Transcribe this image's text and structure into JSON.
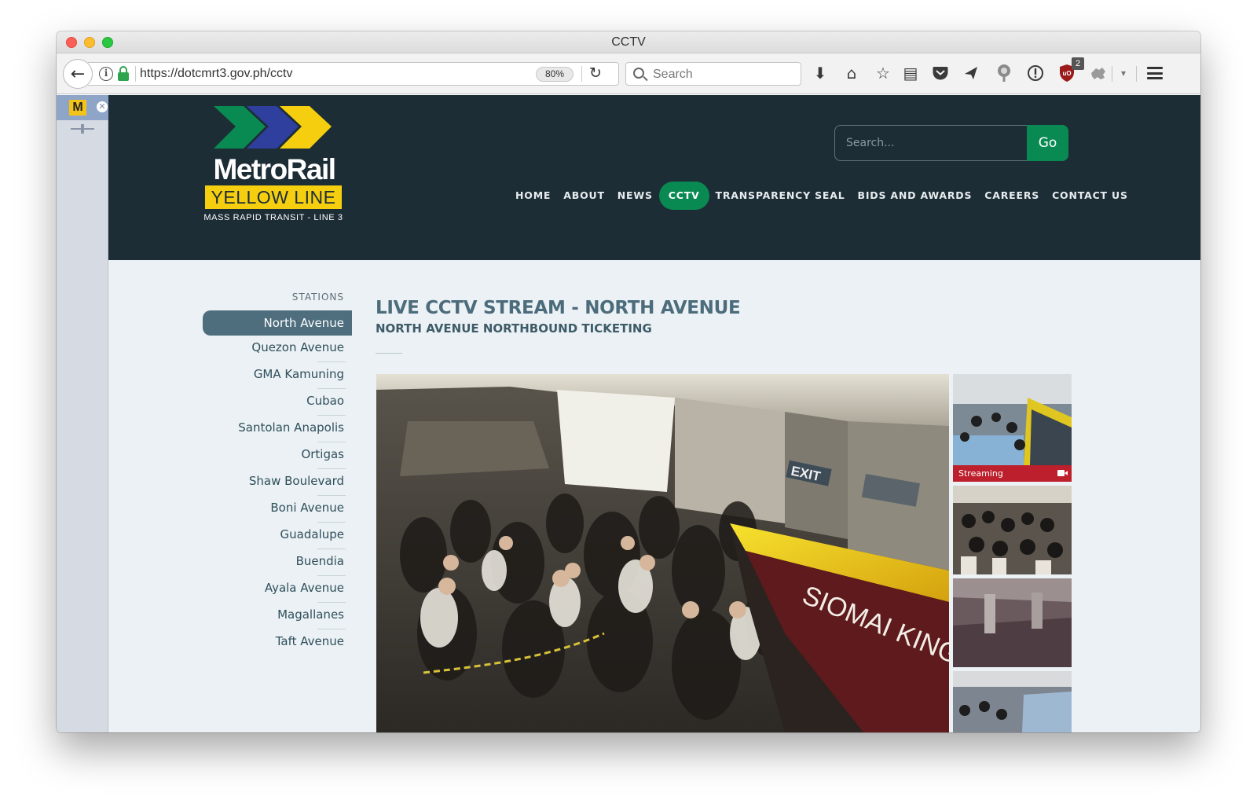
{
  "window": {
    "title": "CCTV"
  },
  "toolbar": {
    "url": "https://dotcmrt3.gov.ph/cctv",
    "zoom": "80%",
    "search_placeholder": "Search",
    "ublock_count": "2",
    "icons": [
      "back-icon",
      "info-icon",
      "lock-icon",
      "reload-icon",
      "search-icon",
      "download-icon",
      "home-icon",
      "bookmark-star-icon",
      "reader-icon",
      "pocket-icon",
      "send-icon",
      "extension-icon",
      "password-icon",
      "ublock-icon",
      "puzzle-icon",
      "dropdown-icon",
      "menu-icon"
    ]
  },
  "tab_strip": {
    "active_tab_letter": "M"
  },
  "site": {
    "logo": {
      "word": "MetroRail",
      "line": "YELLOW LINE",
      "subtitle": "MASS RAPID TRANSIT - LINE 3",
      "colors": [
        "#0a8a53",
        "#2e3f9e",
        "#f5cf0f"
      ]
    },
    "search": {
      "placeholder": "Search...",
      "button": "Go"
    },
    "nav": [
      {
        "label": "HOME",
        "active": false
      },
      {
        "label": "ABOUT",
        "active": false
      },
      {
        "label": "NEWS",
        "active": false
      },
      {
        "label": "CCTV",
        "active": true
      },
      {
        "label": "TRANSPARENCY SEAL",
        "active": false
      },
      {
        "label": "BIDS AND AWARDS",
        "active": false
      },
      {
        "label": "CAREERS",
        "active": false
      },
      {
        "label": "CONTACT US",
        "active": false
      }
    ],
    "accent": "#0a8a53",
    "header_bg": "#1d2d35"
  },
  "stations": {
    "label": "STATIONS",
    "items": [
      {
        "label": "North Avenue",
        "active": true
      },
      {
        "label": "Quezon Avenue",
        "active": false
      },
      {
        "label": "GMA Kamuning",
        "active": false
      },
      {
        "label": "Cubao",
        "active": false
      },
      {
        "label": "Santolan Anapolis",
        "active": false
      },
      {
        "label": "Ortigas",
        "active": false
      },
      {
        "label": "Shaw Boulevard",
        "active": false
      },
      {
        "label": "Boni Avenue",
        "active": false
      },
      {
        "label": "Guadalupe",
        "active": false
      },
      {
        "label": "Buendia",
        "active": false
      },
      {
        "label": "Ayala Avenue",
        "active": false
      },
      {
        "label": "Magallanes",
        "active": false
      },
      {
        "label": "Taft Avenue",
        "active": false
      }
    ]
  },
  "stream": {
    "title": "LIVE CCTV STREAM - NORTH AVENUE",
    "subtitle": "NORTH AVENUE NORTHBOUND TICKETING",
    "main_signs": {
      "exit": "EXIT",
      "booth": "SIOMAI KING"
    },
    "thumbnails": [
      {
        "status": "Streaming",
        "active": true
      },
      {
        "status": "",
        "active": false
      },
      {
        "status": "",
        "active": false
      },
      {
        "status": "",
        "active": false
      }
    ],
    "streaming_color": "#bd1f2c"
  }
}
